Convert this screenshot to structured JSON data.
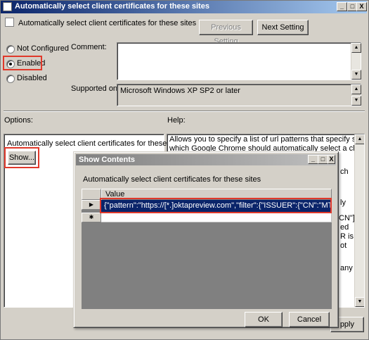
{
  "window": {
    "title": "Automatically select client certificates for these sites",
    "close": "X",
    "setting_name": "Automatically select client certificates for these sites",
    "previous_setting": "Previous Setting",
    "next_setting": "Next Setting",
    "radio": {
      "not_configured": "Not Configured",
      "enabled": "Enabled",
      "disabled": "Disabled",
      "selected": "enabled"
    },
    "comment_label": "Comment:",
    "comment_value": "",
    "supported_on_label": "Supported on:",
    "supported_on_value": "Microsoft Windows XP SP2 or later",
    "options_label": "Options:",
    "help_label": "Help:",
    "options_policy_label": "Automatically select client certificates for these sites",
    "show_button": "Show...",
    "help_text_line1": "Allows you to specify a list of url patterns that specify sites for",
    "help_text_line2": "which Google Chrome should automatically select a client",
    "help_fragments": [
      "ch",
      "ly",
      "CN\"]",
      "ed",
      "R is",
      "ot",
      "any"
    ],
    "apply_partial": "pply"
  },
  "dialog": {
    "title": "Show Contents",
    "description": "Automatically select client certificates for these sites",
    "column_header": "Value",
    "rows": [
      {
        "marker": "▶",
        "value": "{\"pattern\":\"https://[*.]oktapreview.com\",\"filter\":{\"ISSUER\":{\"CN\":\"MTLS  Certificat..."
      },
      {
        "marker": "✱",
        "value": ""
      }
    ],
    "ok": "OK",
    "cancel": "Cancel"
  },
  "colors": {
    "highlight": "#e0392b",
    "title_active": "#0a246a",
    "selection": "#0a246a"
  }
}
